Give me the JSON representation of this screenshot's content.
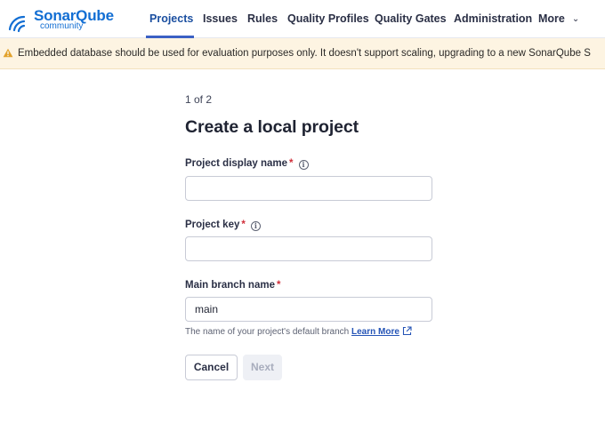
{
  "header": {
    "brand": "SonarQube",
    "edition": "community",
    "nav": [
      {
        "label": "Projects"
      },
      {
        "label": "Issues"
      },
      {
        "label": "Rules"
      },
      {
        "label": "Quality Profiles"
      },
      {
        "label": "Quality Gates"
      },
      {
        "label": "Administration"
      },
      {
        "label": "More"
      }
    ],
    "accent_color": "#3b60c4"
  },
  "banner": {
    "text": "Embedded database should be used for evaluation purposes only. It doesn't support scaling, upgrading to a new SonarQube S",
    "icon": "warning-icon",
    "color": "#fdf4e2"
  },
  "form": {
    "step": "1 of 2",
    "title": "Create a local project",
    "display_name": {
      "label": "Project display name",
      "required_mark": "*",
      "value": ""
    },
    "project_key": {
      "label": "Project key",
      "required_mark": "*",
      "value": ""
    },
    "main_branch": {
      "label": "Main branch name",
      "required_mark": "*",
      "value": "main"
    },
    "help_text": "The name of your project's default branch",
    "learn_more": "Learn More",
    "cancel_label": "Cancel",
    "next_label": "Next"
  }
}
